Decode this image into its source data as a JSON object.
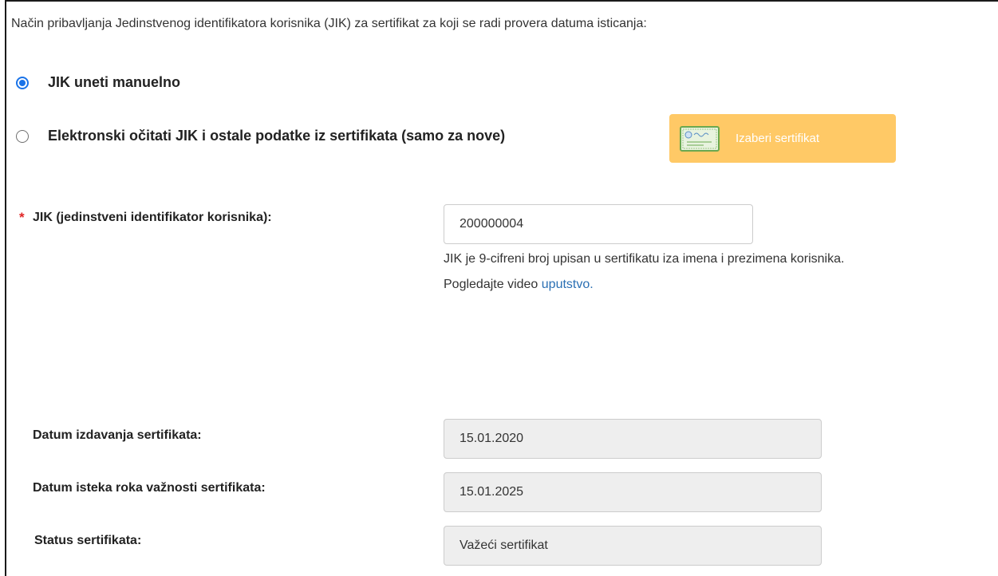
{
  "intro_text": "Način pribavljanja Jedinstvenog identifikatora korisnika (JIK) za sertifikat za koji se radi provera datuma isticanja:",
  "options": {
    "manual": {
      "label": "JIK uneti manuelno",
      "checked": true
    },
    "electronic": {
      "label": "Elektronski očitati JIK i ostale podatke iz sertifikata (samo za nove)",
      "checked": false
    }
  },
  "cert_button": {
    "label": "Izaberi sertifikat",
    "icon": "certificate-icon",
    "color": "#ffc966"
  },
  "jik": {
    "required_marker": "*",
    "label": "JIK (jedinstveni identifikator korisnika):",
    "value": "200000004",
    "help_line1": "JIK je 9-cifreni broj upisan u sertifikatu iza imena i prezimena korisnika.",
    "help_line2_prefix": "Pogledajte video ",
    "help_link": "uputstvo."
  },
  "issue_date": {
    "label": "Datum izdavanja sertifikata:",
    "value": "15.01.2020"
  },
  "expiry_date": {
    "label": "Datum isteka roka važnosti sertifikata:",
    "value": "15.01.2025"
  },
  "status": {
    "label": "Status sertifikata:",
    "value": "Važeći sertifikat"
  },
  "colors": {
    "accent": "#1a73e8",
    "link": "#2a6fb3",
    "required": "#e02424",
    "readonly_bg": "#eeeeee"
  }
}
